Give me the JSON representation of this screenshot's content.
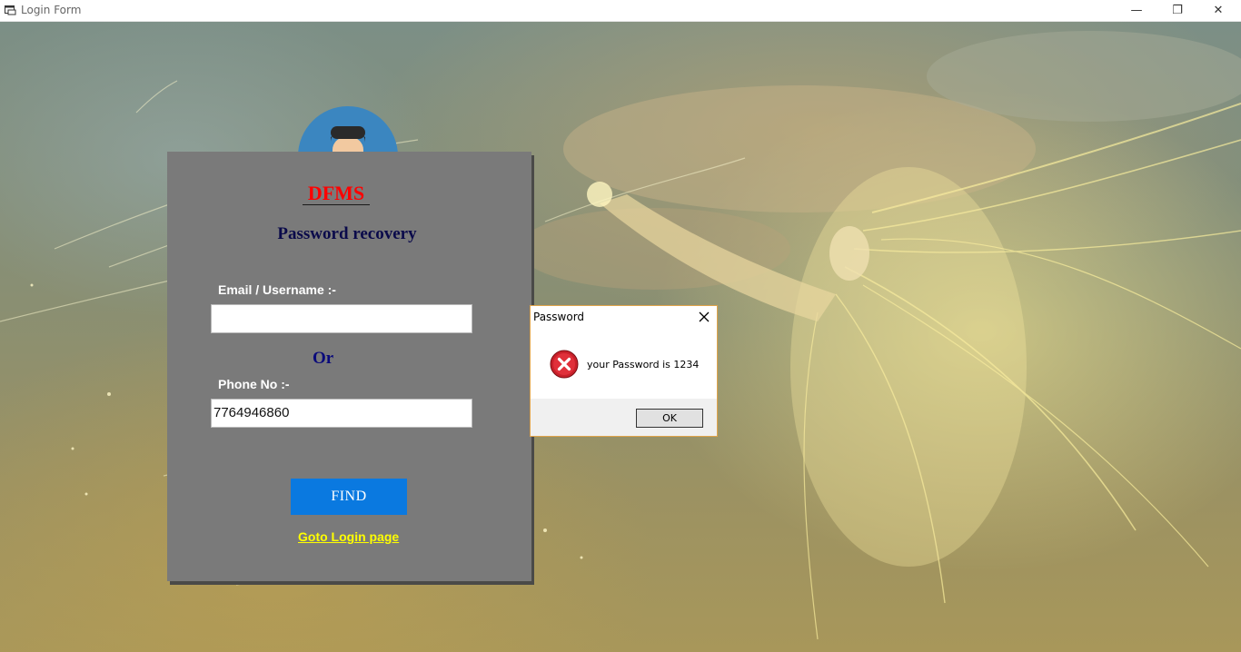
{
  "window": {
    "title": "Login Form",
    "minimize_glyph": "—",
    "restore_glyph": "❐",
    "close_glyph": "✕"
  },
  "form": {
    "brand": "DFMS",
    "subtitle": "Password recovery",
    "email_label": "Email / Username :-",
    "email_value": "",
    "or_label": "Or",
    "phone_label": "Phone No :-",
    "phone_value": "7764946860",
    "find_button": "FIND",
    "goto_login": "Goto Login page"
  },
  "dialog": {
    "title": "Password",
    "message": "your Password is 1234",
    "ok_button": "OK",
    "icon": "error-icon"
  },
  "colors": {
    "brand": "#ff0000",
    "panel": "#7a7a7a",
    "find_button": "#0a79e0",
    "goto_link": "#ffff00",
    "avatar": "#3b86c0"
  }
}
